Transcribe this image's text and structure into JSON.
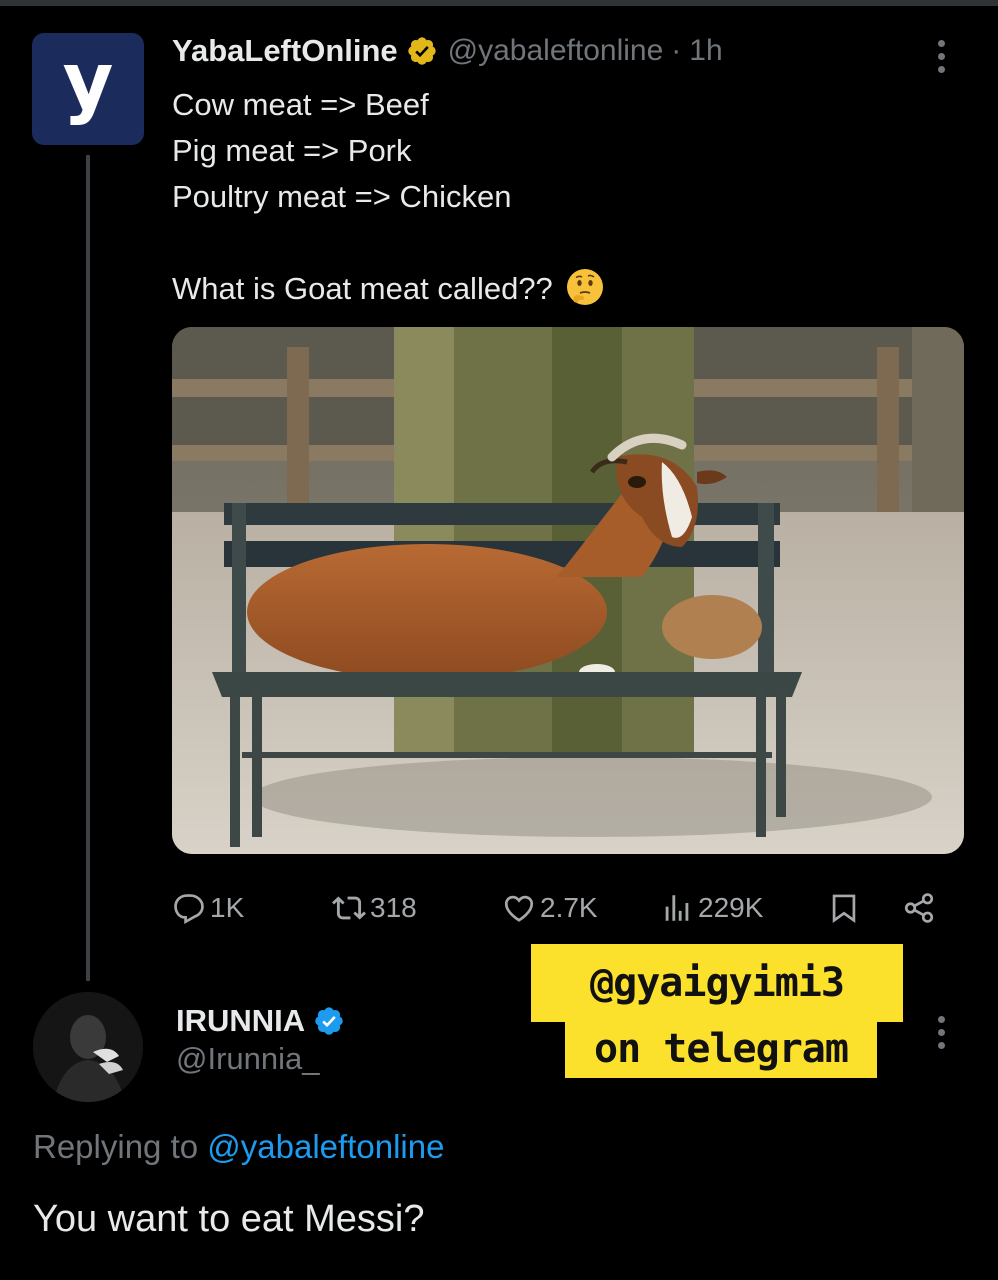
{
  "tweet": {
    "author_name": "YabaLeftOnline",
    "author_handle": "@yabaleftonline",
    "separator": "·",
    "time": "1h",
    "avatar_letter": "y",
    "lines": [
      "Cow meat => Beef",
      "Pig meat => Pork",
      "Poultry meat => Chicken"
    ],
    "question": "What is Goat meat called??",
    "question_emoji": "thinking-face-emoji",
    "media_description": "goat-on-bench-photo",
    "stats": {
      "replies": "1K",
      "reposts": "318",
      "likes": "2.7K",
      "views": "229K"
    }
  },
  "watermark": {
    "line1": "@gyaigyimi3",
    "line2": "on telegram"
  },
  "reply": {
    "author_name": "IRUNNIA",
    "author_handle": "@Irunnia_",
    "replying_prefix": "Replying to",
    "replying_handle": "@yabaleftonline",
    "text": "You want to eat Messi?"
  },
  "colors": {
    "background": "#000000",
    "text": "#e7e9ea",
    "muted": "#71767b",
    "link": "#1d9bf0",
    "gold_badge": "#e2b719",
    "blue_badge": "#1d9bf0",
    "watermark_bg": "#fce12c"
  },
  "icons": [
    "verified-gold-icon",
    "verified-blue-icon",
    "more-icon",
    "reply-icon",
    "repost-icon",
    "like-icon",
    "views-icon",
    "bookmark-icon",
    "share-icon"
  ]
}
